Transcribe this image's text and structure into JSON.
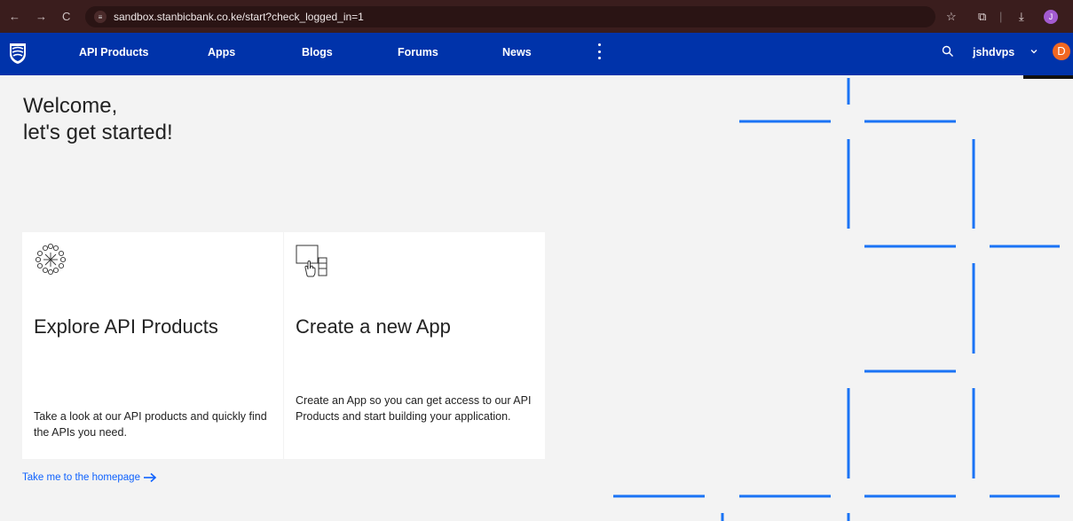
{
  "browser": {
    "url": "sandbox.stanbicbank.co.ke/start?check_logged_in=1",
    "profile_initial": "J"
  },
  "nav": {
    "items": [
      "API Products",
      "Apps",
      "Blogs",
      "Forums",
      "News"
    ],
    "username": "jshdvps",
    "avatar_initial": "D"
  },
  "welcome": {
    "line1": "Welcome,",
    "line2": "let's get started!"
  },
  "cards": [
    {
      "title": "Explore API Products",
      "description": "Take a look at our API products and quickly find the APIs you need."
    },
    {
      "title": "Create a new App",
      "description": "Create an App so you can get access to our API Products and start building your application."
    }
  ],
  "homepage_link": "Take me to the homepage",
  "colors": {
    "nav": "#0033aa",
    "accent": "#0f62fe",
    "avatar": "#f26822"
  }
}
